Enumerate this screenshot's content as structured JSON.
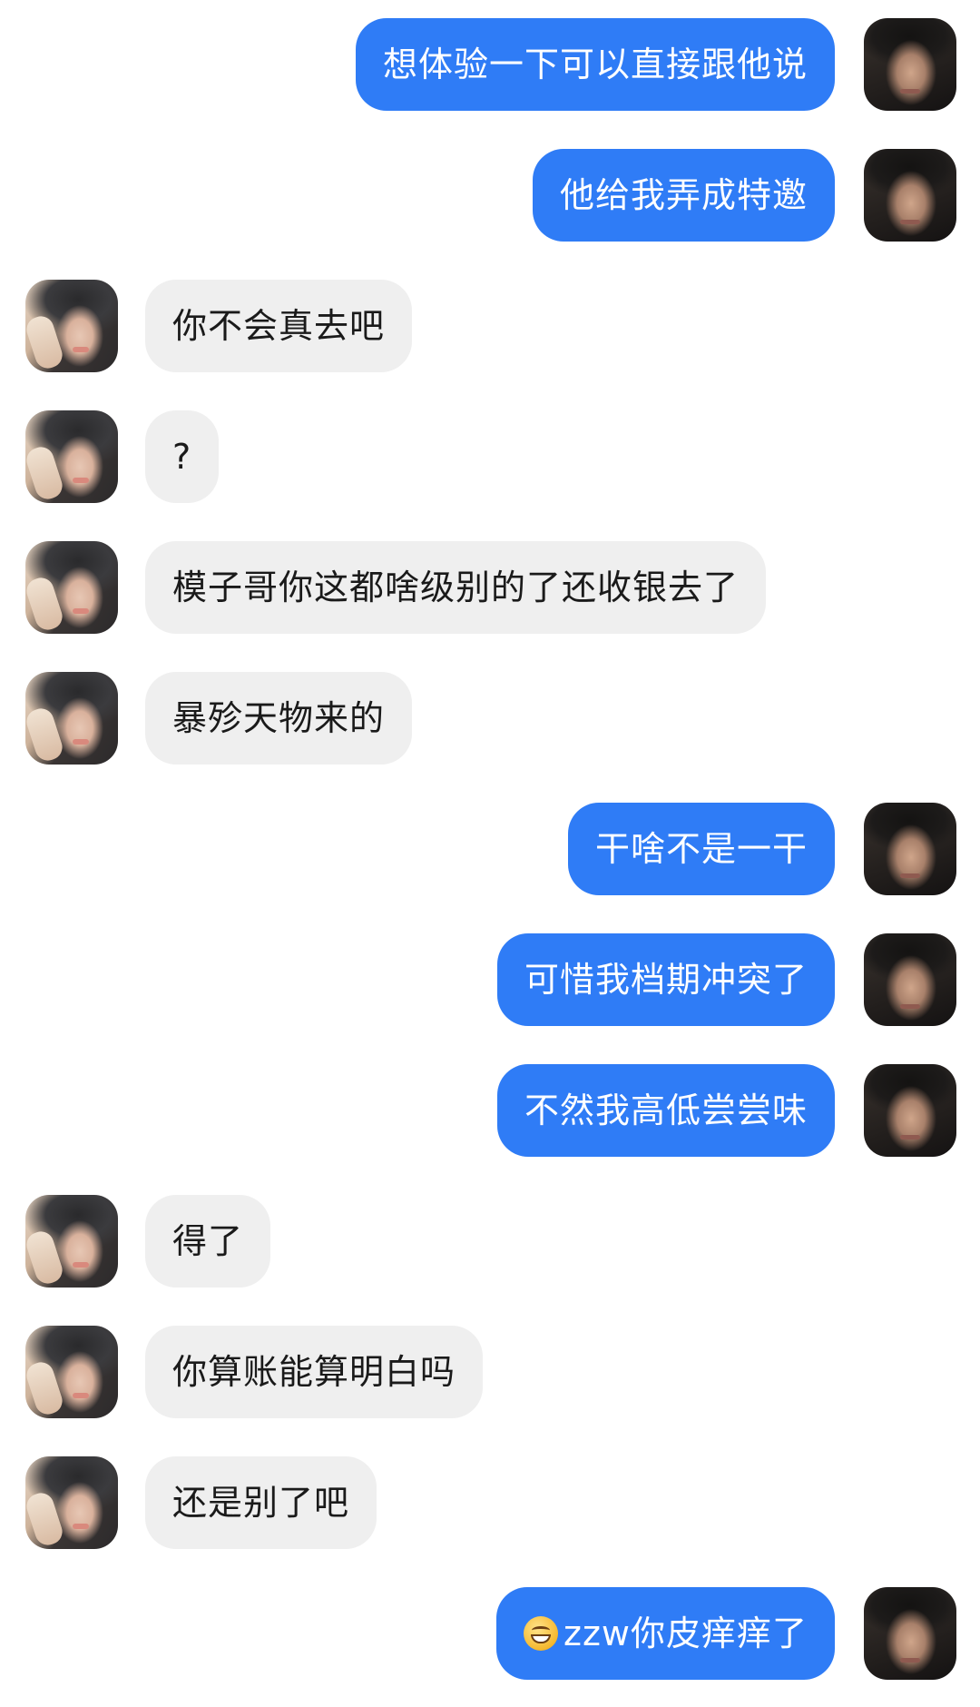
{
  "messages": [
    {
      "side": "right",
      "text": "想体验一下可以直接跟他说"
    },
    {
      "side": "right",
      "text": "他给我弄成特邀"
    },
    {
      "side": "left",
      "text": "你不会真去吧"
    },
    {
      "side": "left",
      "text": "?"
    },
    {
      "side": "left",
      "text": "模子哥你这都啥级别的了还收银去了"
    },
    {
      "side": "left",
      "text": "暴殄天物来的"
    },
    {
      "side": "right",
      "text": "干啥不是一干"
    },
    {
      "side": "right",
      "text": "可惜我档期冲突了"
    },
    {
      "side": "right",
      "text": "不然我高低尝尝味"
    },
    {
      "side": "left",
      "text": "得了"
    },
    {
      "side": "left",
      "text": "你算账能算明白吗"
    },
    {
      "side": "left",
      "text": "还是别了吧"
    },
    {
      "side": "right",
      "text": "zzw你皮痒痒了",
      "emoji": "grinning-face-emoji"
    }
  ],
  "colors": {
    "self_bubble": "#2f7cf6",
    "other_bubble": "#efefef",
    "background": "#ffffff"
  }
}
